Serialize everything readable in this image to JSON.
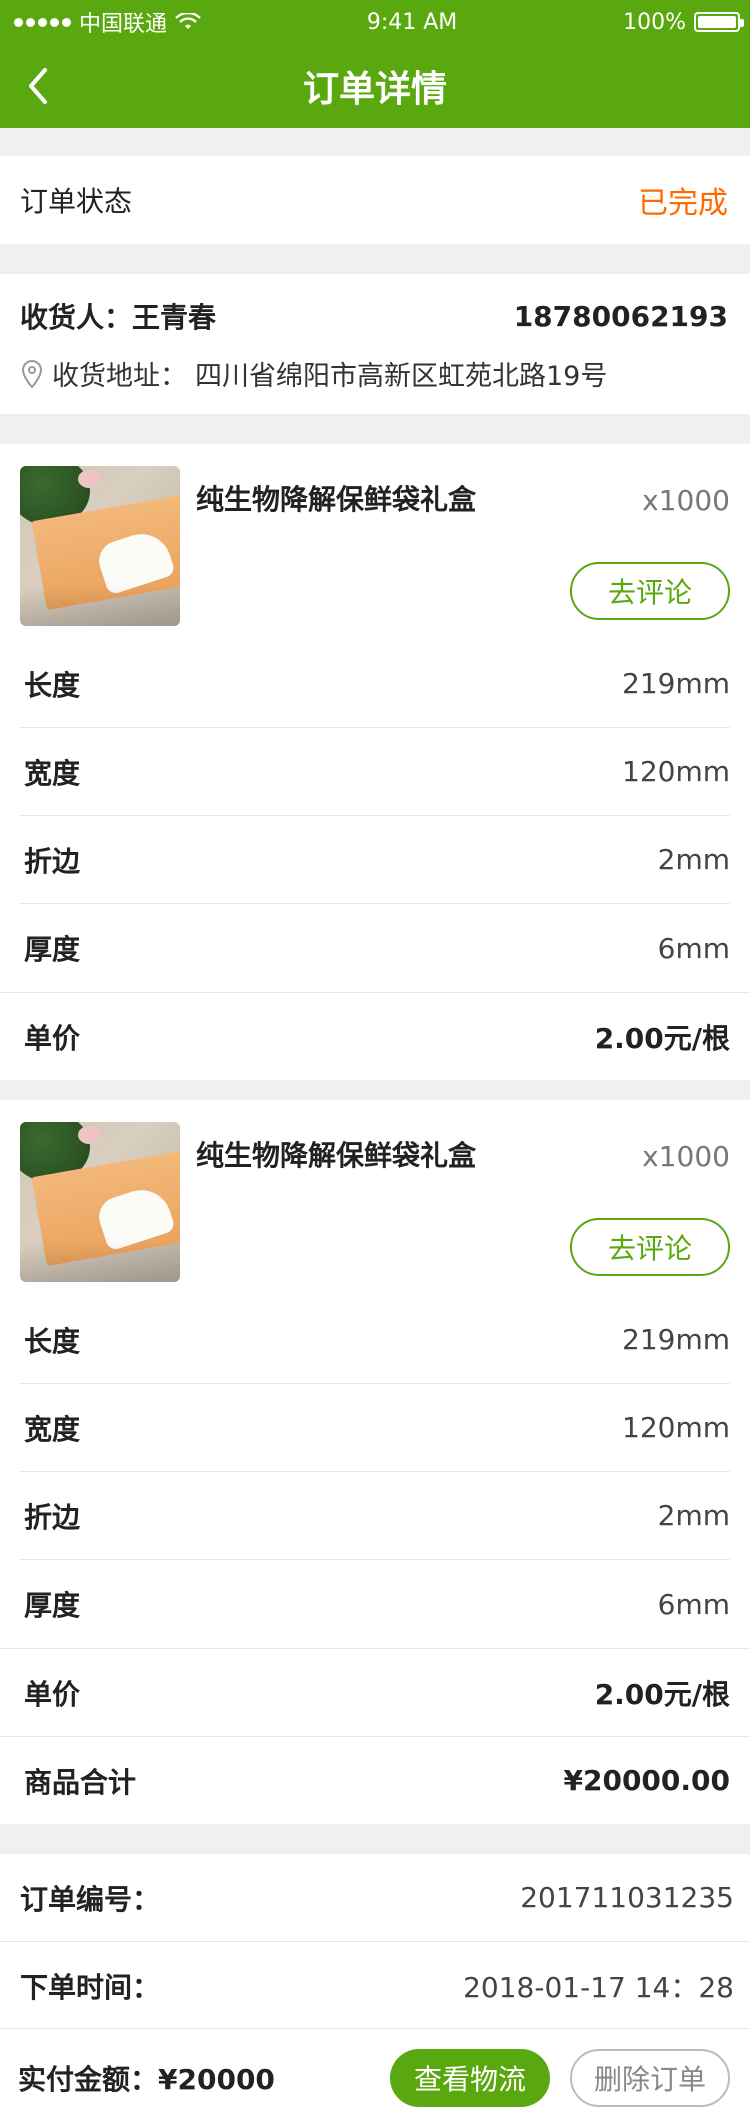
{
  "status_bar": {
    "carrier": "中国联通",
    "time": "9:41 AM",
    "battery": "100%"
  },
  "nav": {
    "title": "订单详情"
  },
  "order_status": {
    "label": "订单状态",
    "value": "已完成"
  },
  "receiver": {
    "name_label": "收货人：",
    "name": "王青春",
    "phone": "18780062193",
    "address_label": "收货地址：",
    "address": "四川省绵阳市高新区虹苑北路19号"
  },
  "products": [
    {
      "name": "纯生物降解保鲜袋礼盒",
      "qty": "x1000",
      "review_label": "去评论",
      "specs": [
        {
          "label": "长度",
          "value": "219mm"
        },
        {
          "label": "宽度",
          "value": "120mm"
        },
        {
          "label": "折边",
          "value": "2mm"
        },
        {
          "label": "厚度",
          "value": "6mm"
        }
      ],
      "price_label": "单价",
      "price": "2.00元/根"
    },
    {
      "name": "纯生物降解保鲜袋礼盒",
      "qty": "x1000",
      "review_label": "去评论",
      "specs": [
        {
          "label": "长度",
          "value": "219mm"
        },
        {
          "label": "宽度",
          "value": "120mm"
        },
        {
          "label": "折边",
          "value": "2mm"
        },
        {
          "label": "厚度",
          "value": "6mm"
        }
      ],
      "price_label": "单价",
      "price": "2.00元/根"
    }
  ],
  "total": {
    "label": "商品合计",
    "value": "¥20000.00"
  },
  "order_info": {
    "number_label": "订单编号：",
    "number": "201711031235",
    "time_label": "下单时间：",
    "time": "2018-01-17  14：28"
  },
  "bottom": {
    "paid_label": "实付金额：",
    "paid_value": "¥20000",
    "logistics_label": "查看物流",
    "delete_label": "删除订单"
  },
  "colors": {
    "brand_green": "#5aa80f",
    "status_orange": "#ff6a00"
  }
}
